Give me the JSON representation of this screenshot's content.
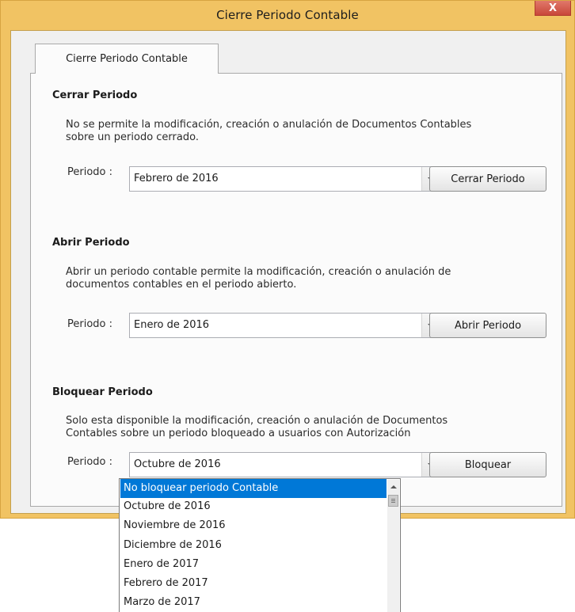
{
  "window": {
    "title": "Cierre Periodo Contable",
    "close_label": "X"
  },
  "tab": {
    "label": "Cierre Periodo Contable"
  },
  "cerrar": {
    "title": "Cerrar Periodo",
    "desc_line1": "No se permite la modificación, creación o anulación de Documentos Contables",
    "desc_line2": "sobre un periodo cerrado.",
    "periodo_label": "Periodo :",
    "selected": "Febrero de 2016",
    "button": "Cerrar Periodo"
  },
  "abrir": {
    "title": "Abrir Periodo",
    "desc_line1": "Abrir un periodo contable permite la modificación, creación o anulación de",
    "desc_line2": "documentos contables en el periodo abierto.",
    "periodo_label": "Periodo :",
    "selected": "Enero de 2016",
    "button": "Abrir Periodo"
  },
  "bloquear": {
    "title": "Bloquear Periodo",
    "desc_line1": "Solo esta disponible la modificación, creación o anulación de Documentos",
    "desc_line2": "Contables sobre un periodo bloqueado a usuarios con Autorización",
    "periodo_label": "Periodo :",
    "selected": "Octubre de 2016",
    "button": "Bloquear",
    "dropdown_options": [
      "No bloquear periodo Contable",
      "Octubre de 2016",
      "Noviembre de 2016",
      "Diciembre de 2016",
      "Enero de 2017",
      "Febrero de 2017",
      "Marzo de 2017"
    ],
    "highlighted_option": "No bloquear periodo Contable"
  },
  "colors": {
    "window_frame": "#f1c363",
    "close_button": "#c9473a",
    "selection": "#0078d7"
  }
}
